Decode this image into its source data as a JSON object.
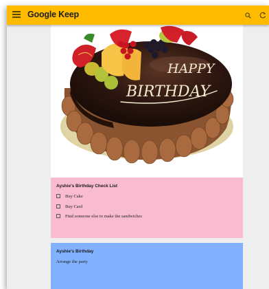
{
  "app": {
    "title": "Google Keep"
  },
  "toolbar": {
    "menu_icon": "menu-icon",
    "search_icon": "search-icon",
    "refresh_icon": "refresh-icon"
  },
  "colors": {
    "toolbar": "#ffbb00",
    "background": "#eeeeee",
    "pink_note": "#f8bbd0",
    "blue_note": "#82b1ff"
  },
  "notes": [
    {
      "image": {
        "icon": "birthday-cake-image",
        "cake_text": [
          "HAPPY",
          "BIRTHDAY"
        ]
      }
    },
    {
      "title": "Ayshie's Birthday Check List",
      "checklist": [
        {
          "label": "Buy Cake",
          "checked": false
        },
        {
          "label": "Buy Card",
          "checked": false
        },
        {
          "label": "Find someone else to  make the sandwiches",
          "checked": false
        }
      ]
    },
    {
      "title": "Ayshie's Birthday",
      "body": "Arrange the party"
    }
  ]
}
